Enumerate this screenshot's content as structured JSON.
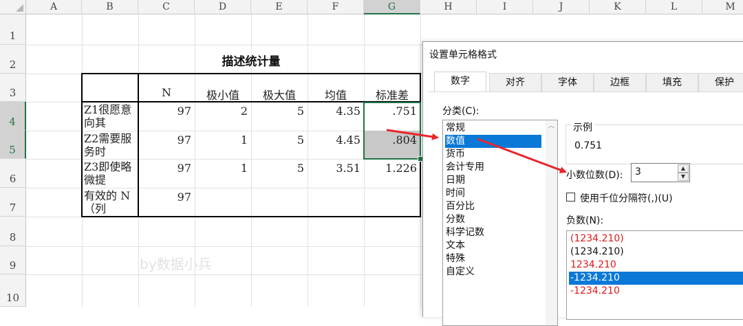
{
  "spreadsheet": {
    "columns": [
      "A",
      "B",
      "C",
      "D",
      "E",
      "F",
      "G",
      "H",
      "I",
      "J",
      "K",
      "L",
      "M"
    ],
    "rows": [
      "1",
      "2",
      "3",
      "4",
      "5",
      "6",
      "7",
      "8",
      "9",
      "10"
    ],
    "selected_column": "G",
    "selected_rows": [
      "4",
      "5"
    ],
    "title": "描述统计量",
    "table": {
      "headers": [
        "",
        "N",
        "极小值",
        "极大值",
        "均值",
        "标准差"
      ],
      "rows": [
        {
          "label": "Z1很愿意向其",
          "n": "97",
          "min": "2",
          "max": "5",
          "mean": "4.35",
          "sd": ".751"
        },
        {
          "label": "Z2需要服务时",
          "n": "97",
          "min": "1",
          "max": "5",
          "mean": "4.45",
          "sd": ".804"
        },
        {
          "label": "Z3即使略微提",
          "n": "97",
          "min": "1",
          "max": "5",
          "mean": "3.51",
          "sd": "1.226"
        },
        {
          "label": "有效的 N（列",
          "n": "97",
          "min": "",
          "max": "",
          "mean": "",
          "sd": ""
        }
      ]
    },
    "watermark": "by数据小兵"
  },
  "dialog": {
    "title": "设置单元格格式",
    "tabs": [
      "数字",
      "对齐",
      "字体",
      "边框",
      "填充",
      "保护"
    ],
    "active_tab": "数字",
    "category_label": "分类(C):",
    "categories": [
      "常规",
      "数值",
      "货币",
      "会计专用",
      "日期",
      "时间",
      "百分比",
      "分数",
      "科学记数",
      "文本",
      "特殊",
      "自定义"
    ],
    "selected_category": "数值",
    "sample_label": "示例",
    "sample_value": "0.751",
    "decimal_label": "小数位数(D):",
    "decimal_value": "3",
    "thousands_label": "使用千位分隔符(,)(U)",
    "thousands_checked": false,
    "negative_label": "负数(N):",
    "negative_options": [
      {
        "text": "(1234.210)",
        "color": "#e01616"
      },
      {
        "text": "(1234.210)",
        "color": "#111111"
      },
      {
        "text": "1234.210",
        "color": "#e01616"
      },
      {
        "text": "-1234.210",
        "color": "#111111",
        "selected": true
      },
      {
        "text": "-1234.210",
        "color": "#e01616"
      }
    ]
  },
  "colors": {
    "excel_green": "#217346",
    "selection_blue": "#0a78d7",
    "arrow_red": "#e8262b"
  }
}
